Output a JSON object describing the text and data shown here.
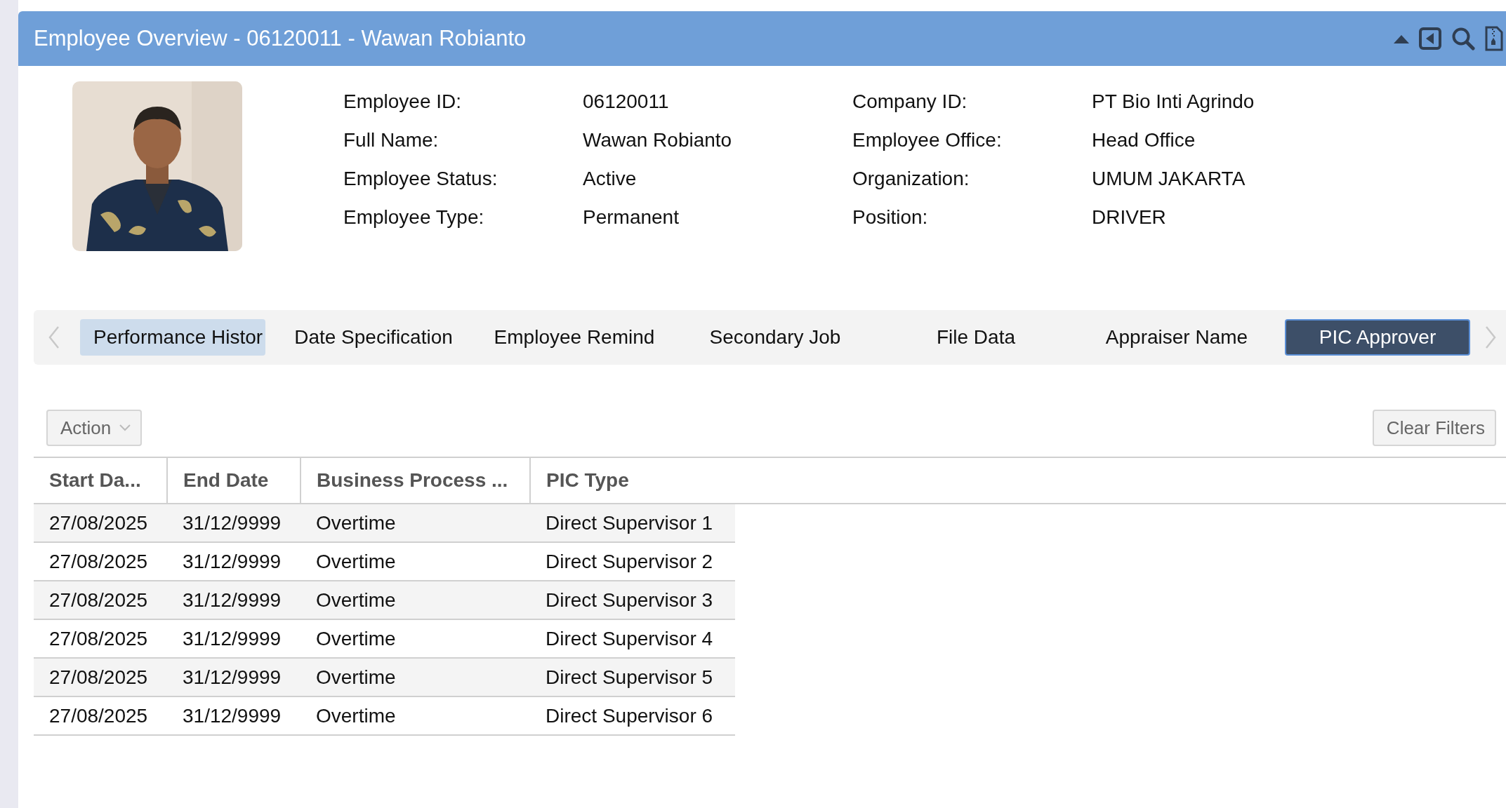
{
  "window": {
    "title": "Employee Overview - 06120011 - Wawan Robianto"
  },
  "profile": {
    "fields": [
      {
        "label": "Employee ID:",
        "value": "06120011"
      },
      {
        "label": "Company ID:",
        "value": "PT Bio Inti Agrindo"
      },
      {
        "label": "Full Name:",
        "value": "Wawan Robianto"
      },
      {
        "label": "Employee Office:",
        "value": "Head Office"
      },
      {
        "label": "Employee Status:",
        "value": "Active"
      },
      {
        "label": "Organization:",
        "value": "UMUM JAKARTA"
      },
      {
        "label": "Employee Type:",
        "value": "Permanent"
      },
      {
        "label": "Position:",
        "value": "DRIVER"
      }
    ]
  },
  "tabs": [
    {
      "label": "Performance Histor",
      "selected": false,
      "highlighted": true
    },
    {
      "label": "Date Specification",
      "selected": false,
      "highlighted": false
    },
    {
      "label": "Employee Remind",
      "selected": false,
      "highlighted": false
    },
    {
      "label": "Secondary Job",
      "selected": false,
      "highlighted": false
    },
    {
      "label": "File Data",
      "selected": false,
      "highlighted": false
    },
    {
      "label": "Appraiser Name",
      "selected": false,
      "highlighted": false
    },
    {
      "label": "PIC Approver",
      "selected": true,
      "highlighted": false
    }
  ],
  "toolbar": {
    "action": "Action",
    "clear": "Clear Filters"
  },
  "table": {
    "columns": [
      "Start Da...",
      "End Date",
      "Business Process ...",
      "PIC Type"
    ],
    "rows": [
      [
        "27/08/2025",
        "31/12/9999",
        "Overtime",
        "Direct Supervisor 1"
      ],
      [
        "27/08/2025",
        "31/12/9999",
        "Overtime",
        "Direct Supervisor 2"
      ],
      [
        "27/08/2025",
        "31/12/9999",
        "Overtime",
        "Direct Supervisor 3"
      ],
      [
        "27/08/2025",
        "31/12/9999",
        "Overtime",
        "Direct Supervisor 4"
      ],
      [
        "27/08/2025",
        "31/12/9999",
        "Overtime",
        "Direct Supervisor 5"
      ],
      [
        "27/08/2025",
        "31/12/9999",
        "Overtime",
        "Direct Supervisor 6"
      ]
    ]
  }
}
